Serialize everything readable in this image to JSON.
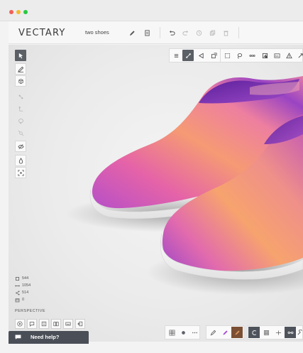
{
  "app": {
    "logo": "VECTARY",
    "document_name": "two shoes"
  },
  "window_controls": {
    "colors": [
      "#f25f57",
      "#f6bb2e",
      "#2ac840"
    ]
  },
  "top_toolbar": {
    "icons": [
      "pencil-icon",
      "document-icon",
      "undo-icon",
      "redo-icon",
      "history-icon",
      "copy-icon",
      "trash-icon"
    ]
  },
  "left_toolbar": {
    "tools": [
      "select-arrow-icon",
      "draw-pen-icon",
      "cube-icon",
      "edge-icon",
      "vertex-icon",
      "lasso-icon",
      "scale-icon",
      "visibility-icon",
      "material-drop-icon",
      "focus-icon"
    ]
  },
  "viewport_toolbar": {
    "tools": [
      "menu-icon",
      "move-icon",
      "rotate-icon",
      "scale-icon",
      "box-select-icon",
      "lasso-select-icon",
      "loop-select-icon",
      "invert-select-icon",
      "select-all-icon",
      "warning-icon",
      "expand-icon"
    ]
  },
  "stats": {
    "vertices": "544",
    "edges": "1054",
    "faces": "514",
    "objects": "0"
  },
  "camera": {
    "mode": "PERSPECTIVE"
  },
  "help": {
    "label": "Need help?"
  },
  "colors": {
    "accent_dark": "#4a4f57",
    "shoe_pink": "#e05aa6",
    "shoe_orange": "#f4a66a",
    "shoe_purple": "#7b3fb5"
  }
}
